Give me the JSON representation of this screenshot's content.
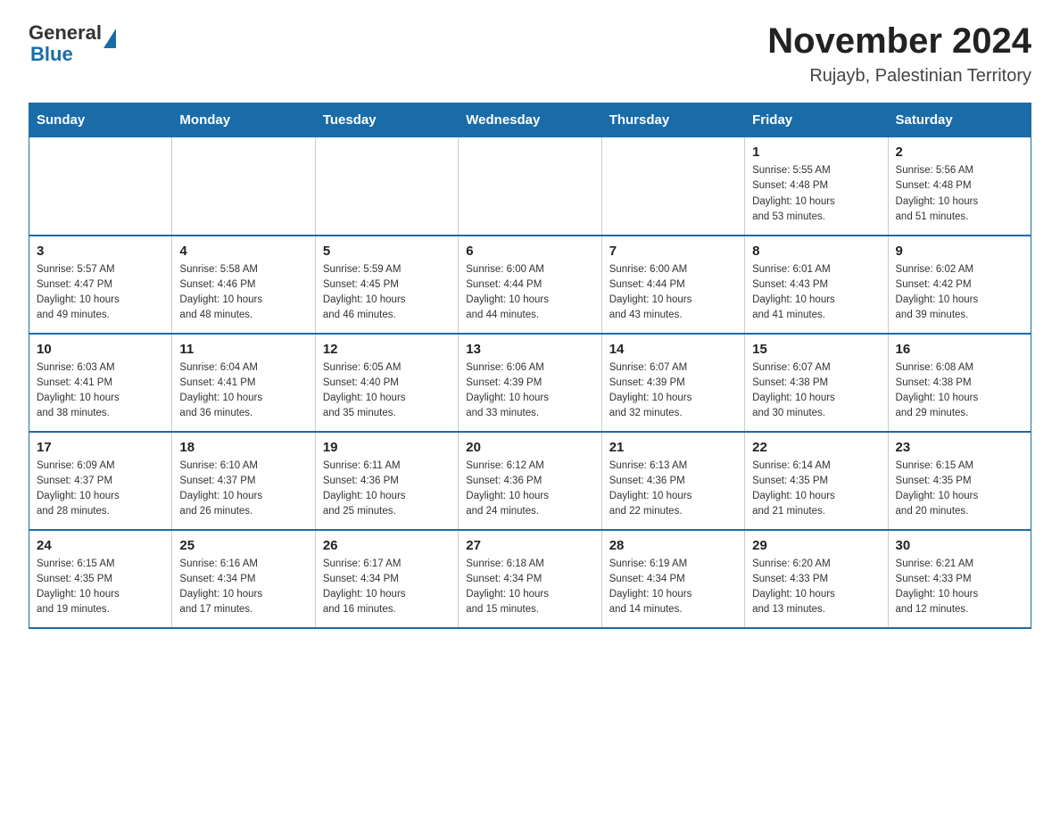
{
  "logo": {
    "general": "General",
    "blue": "Blue"
  },
  "title": "November 2024",
  "subtitle": "Rujayb, Palestinian Territory",
  "days_of_week": [
    "Sunday",
    "Monday",
    "Tuesday",
    "Wednesday",
    "Thursday",
    "Friday",
    "Saturday"
  ],
  "weeks": [
    [
      {
        "day": "",
        "info": ""
      },
      {
        "day": "",
        "info": ""
      },
      {
        "day": "",
        "info": ""
      },
      {
        "day": "",
        "info": ""
      },
      {
        "day": "",
        "info": ""
      },
      {
        "day": "1",
        "info": "Sunrise: 5:55 AM\nSunset: 4:48 PM\nDaylight: 10 hours\nand 53 minutes."
      },
      {
        "day": "2",
        "info": "Sunrise: 5:56 AM\nSunset: 4:48 PM\nDaylight: 10 hours\nand 51 minutes."
      }
    ],
    [
      {
        "day": "3",
        "info": "Sunrise: 5:57 AM\nSunset: 4:47 PM\nDaylight: 10 hours\nand 49 minutes."
      },
      {
        "day": "4",
        "info": "Sunrise: 5:58 AM\nSunset: 4:46 PM\nDaylight: 10 hours\nand 48 minutes."
      },
      {
        "day": "5",
        "info": "Sunrise: 5:59 AM\nSunset: 4:45 PM\nDaylight: 10 hours\nand 46 minutes."
      },
      {
        "day": "6",
        "info": "Sunrise: 6:00 AM\nSunset: 4:44 PM\nDaylight: 10 hours\nand 44 minutes."
      },
      {
        "day": "7",
        "info": "Sunrise: 6:00 AM\nSunset: 4:44 PM\nDaylight: 10 hours\nand 43 minutes."
      },
      {
        "day": "8",
        "info": "Sunrise: 6:01 AM\nSunset: 4:43 PM\nDaylight: 10 hours\nand 41 minutes."
      },
      {
        "day": "9",
        "info": "Sunrise: 6:02 AM\nSunset: 4:42 PM\nDaylight: 10 hours\nand 39 minutes."
      }
    ],
    [
      {
        "day": "10",
        "info": "Sunrise: 6:03 AM\nSunset: 4:41 PM\nDaylight: 10 hours\nand 38 minutes."
      },
      {
        "day": "11",
        "info": "Sunrise: 6:04 AM\nSunset: 4:41 PM\nDaylight: 10 hours\nand 36 minutes."
      },
      {
        "day": "12",
        "info": "Sunrise: 6:05 AM\nSunset: 4:40 PM\nDaylight: 10 hours\nand 35 minutes."
      },
      {
        "day": "13",
        "info": "Sunrise: 6:06 AM\nSunset: 4:39 PM\nDaylight: 10 hours\nand 33 minutes."
      },
      {
        "day": "14",
        "info": "Sunrise: 6:07 AM\nSunset: 4:39 PM\nDaylight: 10 hours\nand 32 minutes."
      },
      {
        "day": "15",
        "info": "Sunrise: 6:07 AM\nSunset: 4:38 PM\nDaylight: 10 hours\nand 30 minutes."
      },
      {
        "day": "16",
        "info": "Sunrise: 6:08 AM\nSunset: 4:38 PM\nDaylight: 10 hours\nand 29 minutes."
      }
    ],
    [
      {
        "day": "17",
        "info": "Sunrise: 6:09 AM\nSunset: 4:37 PM\nDaylight: 10 hours\nand 28 minutes."
      },
      {
        "day": "18",
        "info": "Sunrise: 6:10 AM\nSunset: 4:37 PM\nDaylight: 10 hours\nand 26 minutes."
      },
      {
        "day": "19",
        "info": "Sunrise: 6:11 AM\nSunset: 4:36 PM\nDaylight: 10 hours\nand 25 minutes."
      },
      {
        "day": "20",
        "info": "Sunrise: 6:12 AM\nSunset: 4:36 PM\nDaylight: 10 hours\nand 24 minutes."
      },
      {
        "day": "21",
        "info": "Sunrise: 6:13 AM\nSunset: 4:36 PM\nDaylight: 10 hours\nand 22 minutes."
      },
      {
        "day": "22",
        "info": "Sunrise: 6:14 AM\nSunset: 4:35 PM\nDaylight: 10 hours\nand 21 minutes."
      },
      {
        "day": "23",
        "info": "Sunrise: 6:15 AM\nSunset: 4:35 PM\nDaylight: 10 hours\nand 20 minutes."
      }
    ],
    [
      {
        "day": "24",
        "info": "Sunrise: 6:15 AM\nSunset: 4:35 PM\nDaylight: 10 hours\nand 19 minutes."
      },
      {
        "day": "25",
        "info": "Sunrise: 6:16 AM\nSunset: 4:34 PM\nDaylight: 10 hours\nand 17 minutes."
      },
      {
        "day": "26",
        "info": "Sunrise: 6:17 AM\nSunset: 4:34 PM\nDaylight: 10 hours\nand 16 minutes."
      },
      {
        "day": "27",
        "info": "Sunrise: 6:18 AM\nSunset: 4:34 PM\nDaylight: 10 hours\nand 15 minutes."
      },
      {
        "day": "28",
        "info": "Sunrise: 6:19 AM\nSunset: 4:34 PM\nDaylight: 10 hours\nand 14 minutes."
      },
      {
        "day": "29",
        "info": "Sunrise: 6:20 AM\nSunset: 4:33 PM\nDaylight: 10 hours\nand 13 minutes."
      },
      {
        "day": "30",
        "info": "Sunrise: 6:21 AM\nSunset: 4:33 PM\nDaylight: 10 hours\nand 12 minutes."
      }
    ]
  ]
}
